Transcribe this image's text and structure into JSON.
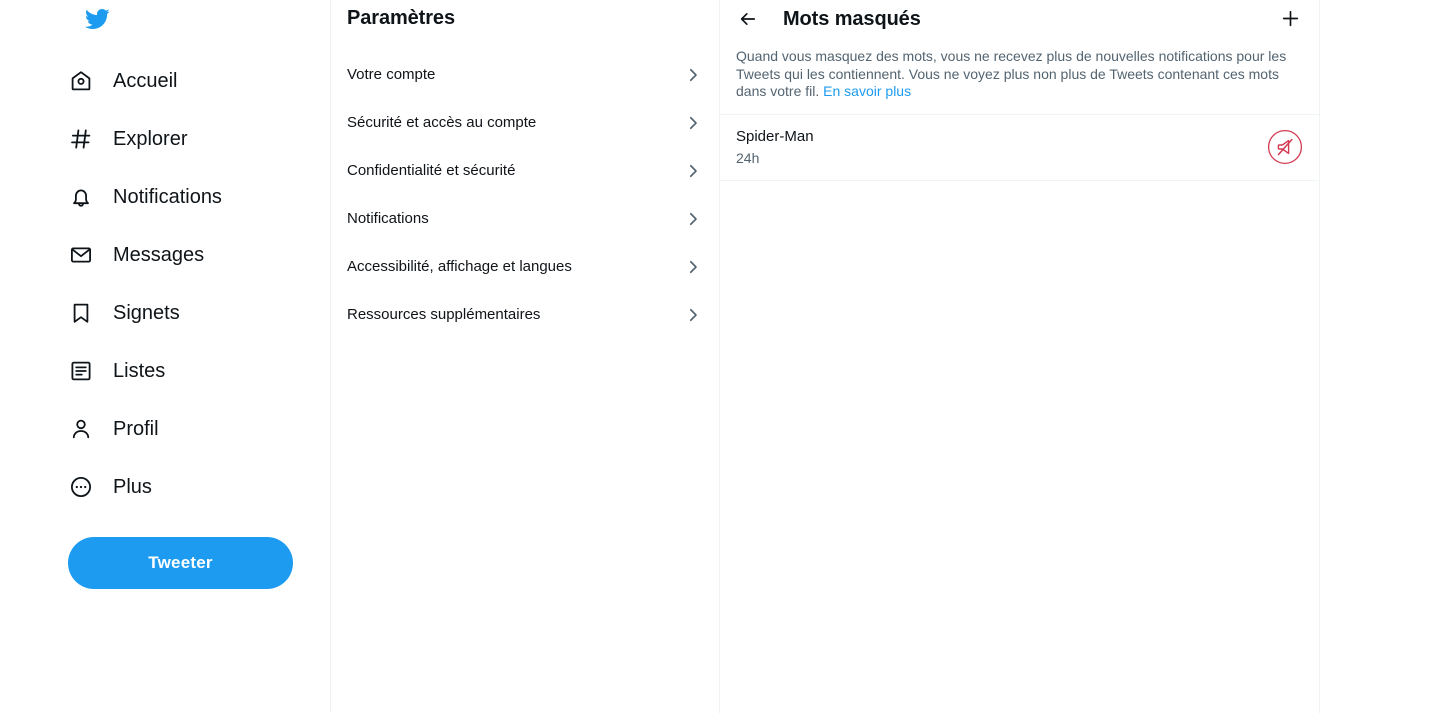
{
  "colors": {
    "brand_blue": "#1d9bf0",
    "text_primary": "#0f1419",
    "text_secondary": "#536471",
    "border": "#eff3f4",
    "mute_red": "#d33a52"
  },
  "sidebar": {
    "logo_name": "twitter-bird-logo",
    "items": [
      {
        "label": "Accueil",
        "icon": "home-icon"
      },
      {
        "label": "Explorer",
        "icon": "hashtag-icon"
      },
      {
        "label": "Notifications",
        "icon": "bell-icon"
      },
      {
        "label": "Messages",
        "icon": "envelope-icon"
      },
      {
        "label": "Signets",
        "icon": "bookmark-icon"
      },
      {
        "label": "Listes",
        "icon": "list-icon"
      },
      {
        "label": "Profil",
        "icon": "person-icon"
      },
      {
        "label": "Plus",
        "icon": "more-circle-icon"
      }
    ],
    "compose_button_label": "Tweeter"
  },
  "settings": {
    "title": "Paramètres",
    "items": [
      {
        "label": "Votre compte"
      },
      {
        "label": "Sécurité et accès au compte"
      },
      {
        "label": "Confidentialité et sécurité"
      },
      {
        "label": "Notifications"
      },
      {
        "label": "Accessibilité, affichage et langues"
      },
      {
        "label": "Ressources supplémentaires"
      }
    ]
  },
  "main": {
    "header": {
      "back_icon": "arrow-left-icon",
      "title": "Mots masqués",
      "add_icon": "plus-icon"
    },
    "description": {
      "text": "Quand vous masquez des mots, vous ne recevez plus de nouvelles notifications pour les Tweets qui les contiennent. Vous ne voyez plus non plus de Tweets contenant ces mots dans votre fil. ",
      "link_text": "En savoir plus"
    },
    "muted_words": [
      {
        "word": "Spider-Man",
        "duration": "24h",
        "action_icon": "speaker-muted-icon"
      }
    ]
  }
}
